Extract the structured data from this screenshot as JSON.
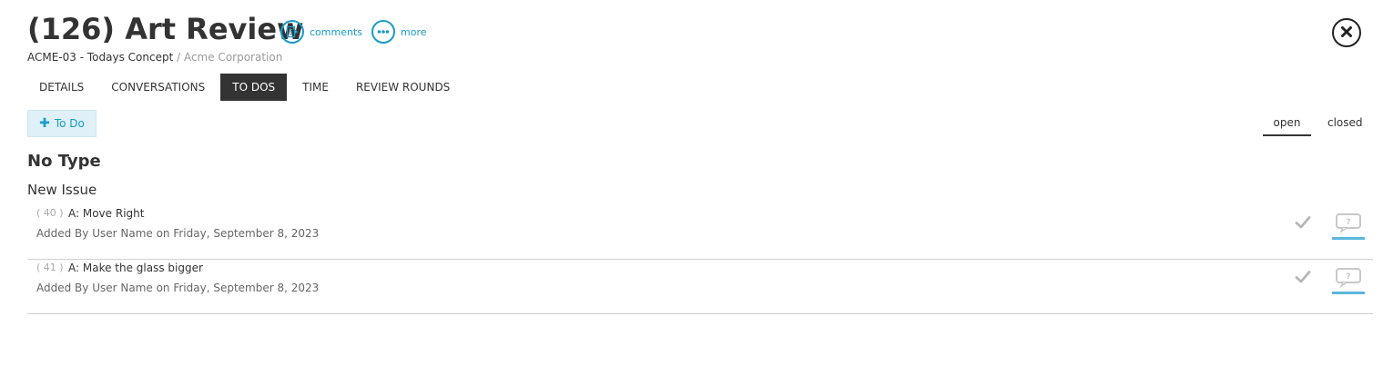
{
  "header": {
    "title": "(126) Art Review",
    "project": "ACME-03 - Todays Concept",
    "separator": " / ",
    "company": "Acme Corporation",
    "actions": [
      {
        "label": "comments",
        "icon": "comments-icon"
      },
      {
        "label": "more",
        "icon": "more-icon"
      }
    ],
    "close_icon": "close-icon"
  },
  "tabs": [
    {
      "label": "DETAILS",
      "active": false
    },
    {
      "label": "CONVERSATIONS",
      "active": false
    },
    {
      "label": "TO DOS",
      "active": true
    },
    {
      "label": "TIME",
      "active": false
    },
    {
      "label": "REVIEW ROUNDS",
      "active": false
    }
  ],
  "toolbar": {
    "add_label": "To Do",
    "filters": [
      {
        "label": "open",
        "active": true
      },
      {
        "label": "closed",
        "active": false
      }
    ]
  },
  "section": {
    "title": "No Type",
    "group_title": "New Issue"
  },
  "todos": [
    {
      "number": "( 40 )",
      "name": "A: Move Right",
      "meta": "Added By User Name on Friday, September 8, 2023"
    },
    {
      "number": "( 41 )",
      "name": "A: Make the glass bigger",
      "meta": "Added By User Name on Friday, September 8, 2023"
    }
  ],
  "colors": {
    "accent": "#1a9bc9",
    "tab_active_bg": "#333333",
    "add_button_bg": "#dff0f9",
    "status_bar": "#5bb6dc"
  }
}
